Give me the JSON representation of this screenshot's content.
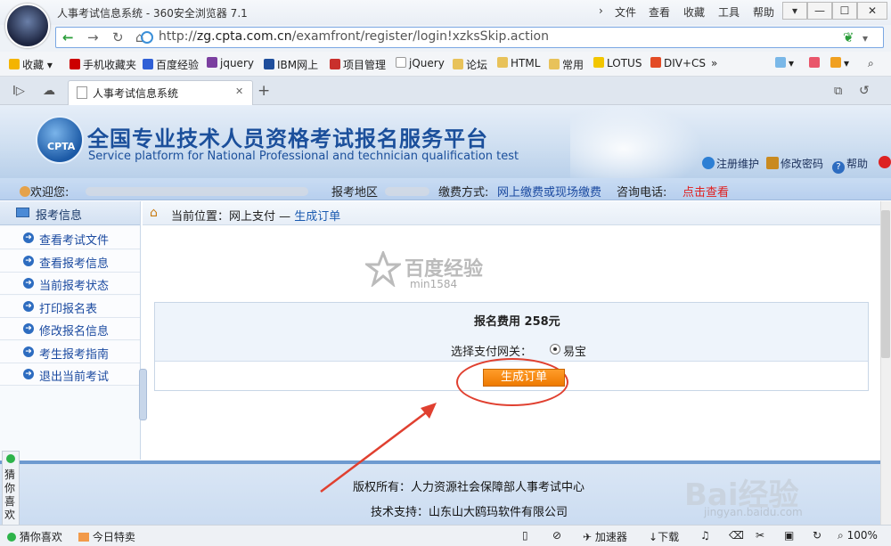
{
  "browser": {
    "title": "人事考试信息系统 - 360安全浏览器 7.1",
    "menus": [
      "文件",
      "查看",
      "收藏",
      "工具",
      "帮助"
    ],
    "url_prefix": "http://",
    "url_host": "zg.cpta.com.cn",
    "url_path": "/examfront/register/login!xzksSkip.action",
    "bookmarks": [
      "收藏",
      "手机收藏夹",
      "百度经验",
      "jquery",
      "IBM网上",
      "项目管理",
      "jQuery",
      "论坛",
      "HTML",
      "常用",
      "LOTUS",
      "DIV+CS"
    ],
    "tab_title": "人事考试信息系统",
    "status": {
      "guess": "猜你喜欢",
      "today": "今日特卖",
      "accel": "加速器",
      "download": "下载",
      "zoom": "100%"
    }
  },
  "site": {
    "title_cn": "全国专业技术人员资格考试报名服务平台",
    "title_en": "Service platform for National Professional and technician qualification test",
    "logo_text": "CPTA",
    "links": [
      "注册维护",
      "修改密码",
      "帮助"
    ],
    "info": {
      "welcome": "欢迎您:",
      "region_label": "报考地区",
      "pay_label": "缴费方式:",
      "pay_value": "网上缴费或现场缴费",
      "phone_label": "咨询电话:",
      "phone_link": "点击查看"
    }
  },
  "sidebar": {
    "header": "报考信息",
    "items": [
      "查看考试文件",
      "查看报考信息",
      "当前报考状态",
      "打印报名表",
      "修改报名信息",
      "考生报考指南",
      "退出当前考试"
    ]
  },
  "breadcrumb": {
    "label": "当前位置：网上支付",
    "sep": "—",
    "current": "生成订单"
  },
  "content": {
    "watermark_title": "百度经验",
    "watermark_user": "min1584",
    "fee_text": "报名费用  258元",
    "gateway_label": "选择支付网关：",
    "gateway_option": "易宝",
    "order_button": "生成订单"
  },
  "footer": {
    "copyright": "版权所有：人力资源社会保障部人事考试中心",
    "tech": "技术支持：山东山大鸥玛软件有限公司",
    "watermark": "Bai经验",
    "watermark_url": "jingyan.baidu.com"
  },
  "side_widget": "猜你喜欢",
  "colors": {
    "accent": "#1b4f9b",
    "order_button": "#ff8a10",
    "annotation": "#e04030"
  }
}
